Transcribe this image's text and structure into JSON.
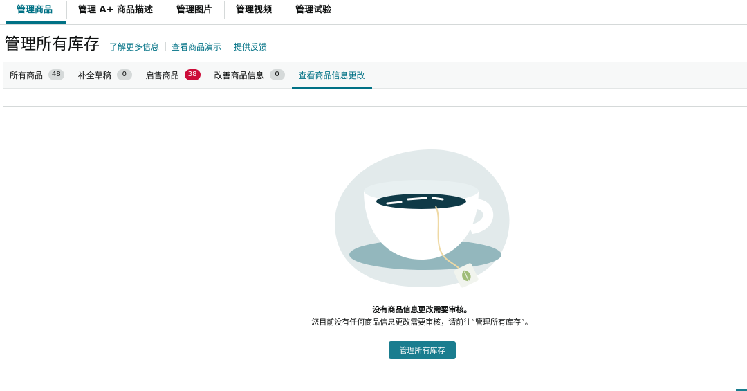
{
  "top_tabs": [
    {
      "label": "管理商品"
    },
    {
      "label": "管理 A+ 商品描述"
    },
    {
      "label": "管理图片"
    },
    {
      "label": "管理视频"
    },
    {
      "label": "管理试验"
    }
  ],
  "page": {
    "title": "管理所有库存",
    "links": [
      "了解更多信息",
      "查看商品演示",
      "提供反馈"
    ]
  },
  "sub_tabs": [
    {
      "label": "所有商品",
      "count": "48"
    },
    {
      "label": "补全草稿",
      "count": "0"
    },
    {
      "label": "启售商品",
      "count": "38"
    },
    {
      "label": "改善商品信息",
      "count": "0"
    },
    {
      "label": "查看商品信息更改"
    }
  ],
  "empty_state": {
    "title": "没有商品信息更改需要审核。",
    "description": "您目前没有任何商品信息更改需要审核，请前往“管理所有库存”。",
    "button_label": "管理所有库存"
  },
  "colors": {
    "accent": "#007185",
    "button": "#1a7d8f",
    "badge_alert": "#cc0c39",
    "badge_neutral": "#d5d9d9"
  },
  "icons": {
    "illustration": "coffee-cup-illustration",
    "tag": "leaf-icon"
  }
}
